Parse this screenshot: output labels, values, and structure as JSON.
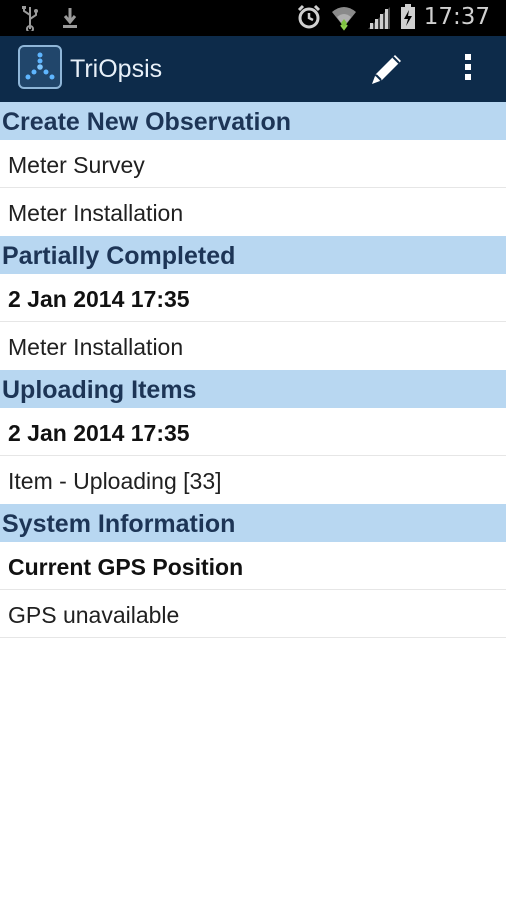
{
  "status_bar": {
    "time": "17:37",
    "left_icons": [
      "usb-icon",
      "download-icon"
    ],
    "right_icons": [
      "alarm-icon",
      "wifi-icon",
      "signal-icon",
      "battery-charging-icon"
    ]
  },
  "action_bar": {
    "app_title": "TriOpsis",
    "actions": [
      "edit-icon",
      "overflow-menu-icon"
    ]
  },
  "sections": [
    {
      "header": "Create New Observation",
      "items": [
        {
          "label": "Meter Survey"
        },
        {
          "label": "Meter Installation"
        }
      ]
    },
    {
      "header": "Partially Completed",
      "items": [
        {
          "label": "2 Jan 2014 17:35"
        },
        {
          "label": "Meter Installation"
        }
      ]
    },
    {
      "header": "Uploading Items",
      "items": [
        {
          "label": "2 Jan 2014 17:35"
        },
        {
          "label": "Item - Uploading [33]"
        }
      ]
    },
    {
      "header": "System Information",
      "items": [
        {
          "label": "Current GPS Position"
        },
        {
          "label": "GPS unavailable"
        }
      ]
    }
  ],
  "colors": {
    "action_bar": "#0d2b4a",
    "section_header_bg": "#b8d7f1",
    "section_header_text": "#1d3556"
  }
}
